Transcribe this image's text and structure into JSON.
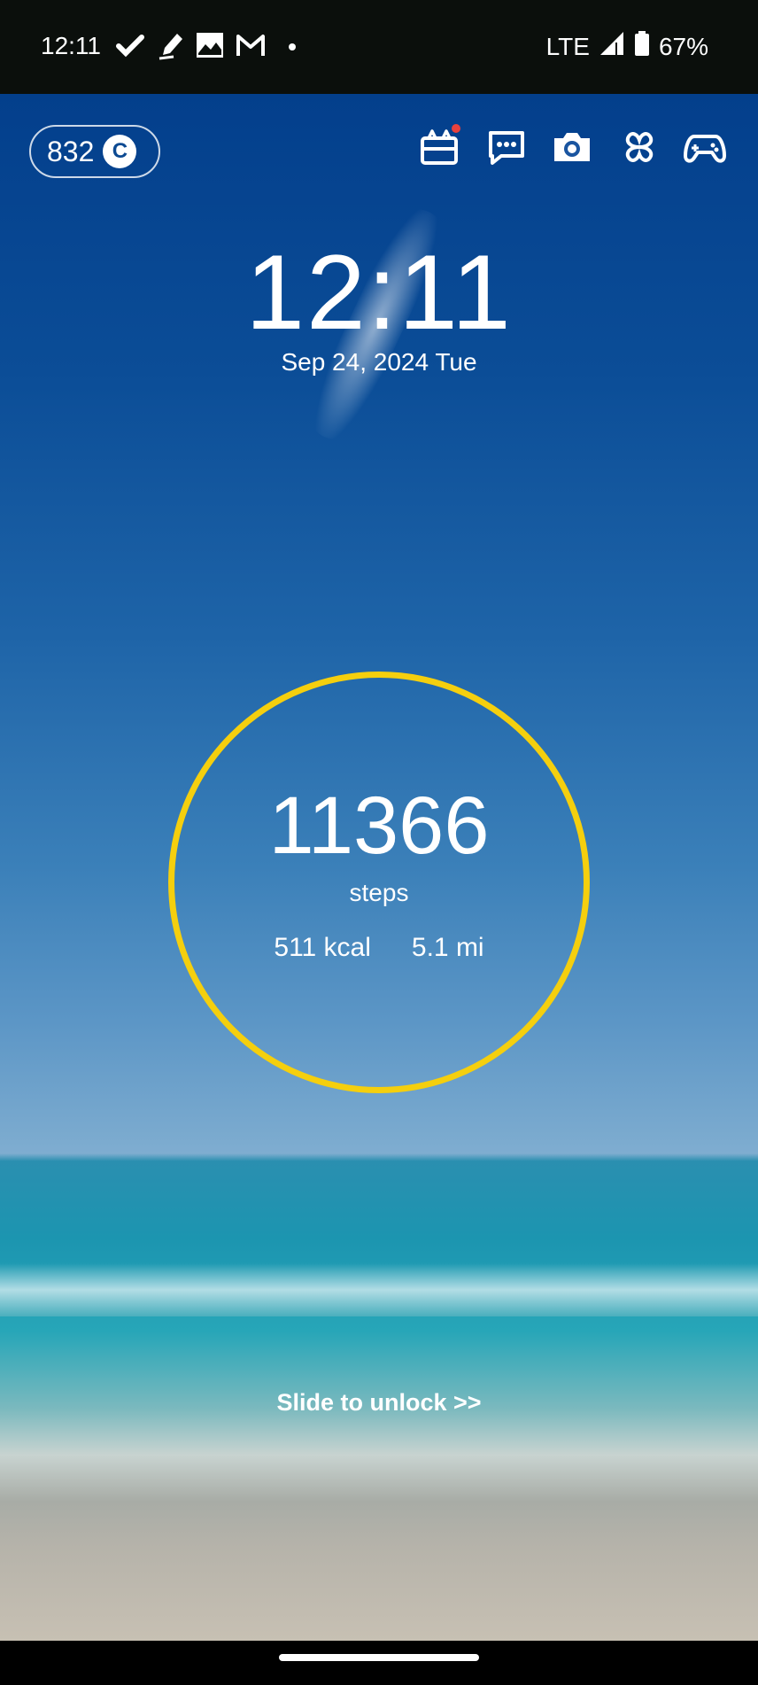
{
  "status_bar": {
    "time": "12:11",
    "network": "LTE",
    "battery": "67%",
    "notification_icons": [
      "check-icon",
      "pen-icon",
      "image-icon",
      "gmail-icon",
      "more-dot-icon"
    ]
  },
  "lock_screen": {
    "coins": "832",
    "coin_symbol": "C",
    "clock": "12:11",
    "date": "Sep 24, 2024 Tue",
    "steps": "11366",
    "steps_label": "steps",
    "calories": "511 kcal",
    "distance": "5.1 mi",
    "unlock_hint": "Slide to unlock >>",
    "top_icons": [
      "rewards-icon",
      "messages-icon",
      "camera-icon",
      "clover-icon",
      "gamepad-icon"
    ]
  },
  "colors": {
    "ring": "#f5cf0e",
    "badge": "#e8413c",
    "sky_top": "#033f8c",
    "sea": "#1c95b0",
    "sand": "#c7c0b3"
  }
}
